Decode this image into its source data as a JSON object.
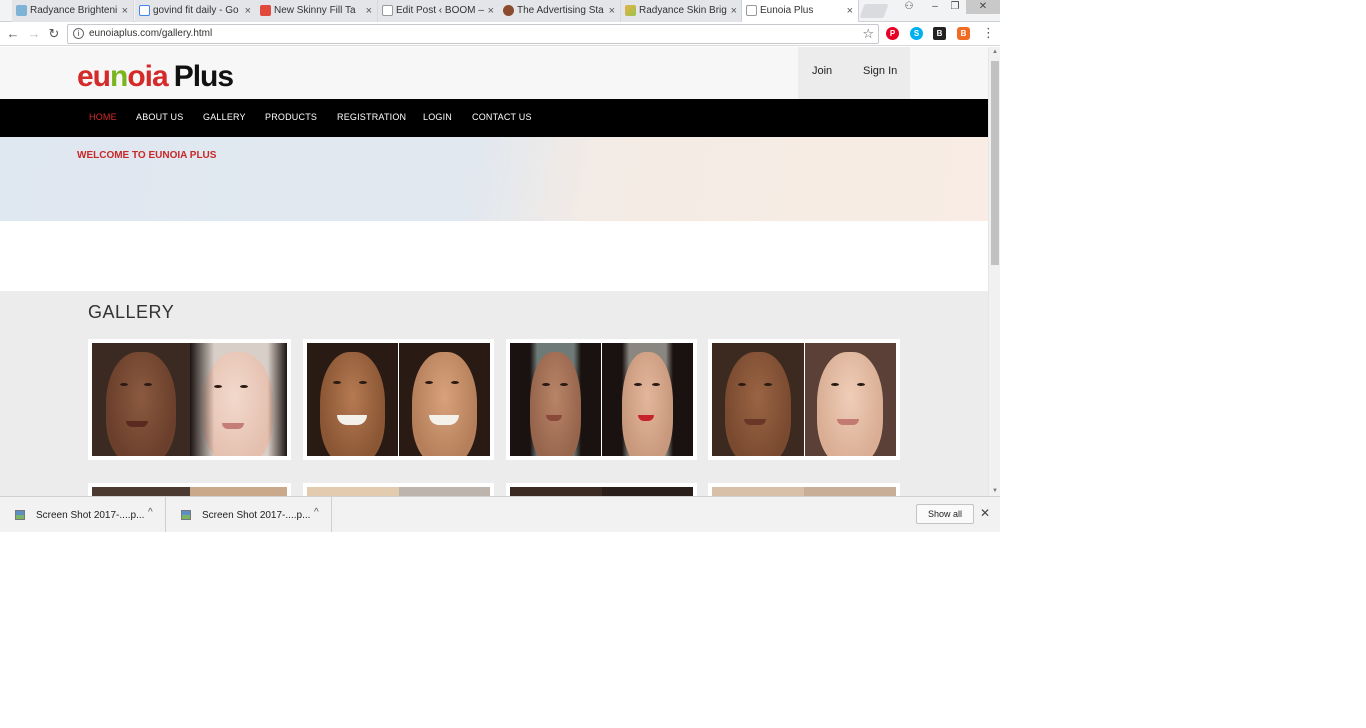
{
  "tabs": [
    {
      "title": "Radyance Brighteni",
      "favicon_color": "#7fb3d5"
    },
    {
      "title": "govind fit daily - Go",
      "favicon_color": "#4285f4"
    },
    {
      "title": "New Skinny Fill Ta",
      "favicon_color": "#e0493c"
    },
    {
      "title": "Edit Post ‹ BOOM —",
      "favicon_color": "#bdbdbd"
    },
    {
      "title": "The Advertising Sta",
      "favicon_color": "#8a4b2e"
    },
    {
      "title": "Radyance Skin Brigh",
      "favicon_color": "#9ac34a"
    },
    {
      "title": "Eunoia Plus",
      "favicon_color": "#bdbdbd"
    }
  ],
  "tab_close_glyph": "×",
  "window_controls": {
    "profile": "⚇",
    "minimize": "–",
    "restore": "❐",
    "close": "✕"
  },
  "toolbar": {
    "back": "←",
    "forward": "→",
    "reload": "↻",
    "info": "i",
    "url": "eunoiaplus.com/gallery.html",
    "star": "☆",
    "extensions": [
      {
        "name": "pinterest-icon",
        "color": "#e60023",
        "glyph": "P"
      },
      {
        "name": "skype-icon",
        "color": "#00aff0",
        "glyph": "S"
      },
      {
        "name": "bookmark-b-icon",
        "color": "#222222",
        "glyph": "B"
      },
      {
        "name": "orange-extension-icon",
        "color": "#f06c22",
        "glyph": "B"
      }
    ],
    "menu": "⋮"
  },
  "site": {
    "logo": {
      "eu": "eu",
      "n": "n",
      "oia": "oia",
      "plus": "Plus"
    },
    "join": "Join",
    "sign_in": "Sign In",
    "nav": [
      {
        "label": "HOME",
        "active": true
      },
      {
        "label": "ABOUT US",
        "active": false
      },
      {
        "label": "GALLERY",
        "active": false
      },
      {
        "label": "PRODUCTS",
        "active": false
      },
      {
        "label": "REGISTRATION",
        "active": false
      },
      {
        "label": "LOGIN",
        "active": false
      },
      {
        "label": "CONTACT US",
        "active": false
      }
    ],
    "welcome": "WELCOME TO EUNOIA PLUS",
    "gallery_heading": "GALLERY"
  },
  "downloads": {
    "items": [
      {
        "name": "Screen Shot 2017-....p..."
      },
      {
        "name": "Screen Shot 2017-....p..."
      }
    ],
    "caret": "^",
    "show_all": "Show all",
    "close": "✕"
  },
  "scrollbar": {
    "up": "▲",
    "down": "▼"
  }
}
